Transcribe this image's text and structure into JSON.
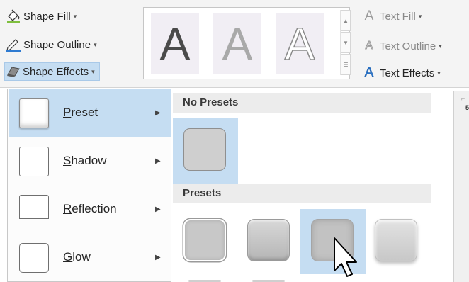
{
  "ribbon": {
    "shape_fill": "Shape Fill",
    "shape_outline": "Shape Outline",
    "shape_effects": "Shape Effects",
    "text_fill": "Text Fill",
    "text_outline": "Text Outline",
    "text_effects": "Text Effects",
    "dropdown_glyph": "▾",
    "wordart_glyph": "A",
    "gallery_letters": [
      "A",
      "A",
      "A"
    ],
    "side_sliver_glyph": "⌐",
    "side_sliver_value": "5"
  },
  "menu": {
    "items": [
      {
        "prefix": "",
        "accel": "P",
        "rest": "reset"
      },
      {
        "prefix": "",
        "accel": "S",
        "rest": "hadow"
      },
      {
        "prefix": "",
        "accel": "R",
        "rest": "eflection"
      },
      {
        "prefix": "",
        "accel": "G",
        "rest": "low"
      }
    ],
    "chevron": "▶"
  },
  "submenu": {
    "no_presets_header": "No Presets",
    "presets_header": "Presets"
  },
  "colors": {
    "highlight": "#c5ddf2",
    "header_bg": "#ececec"
  }
}
